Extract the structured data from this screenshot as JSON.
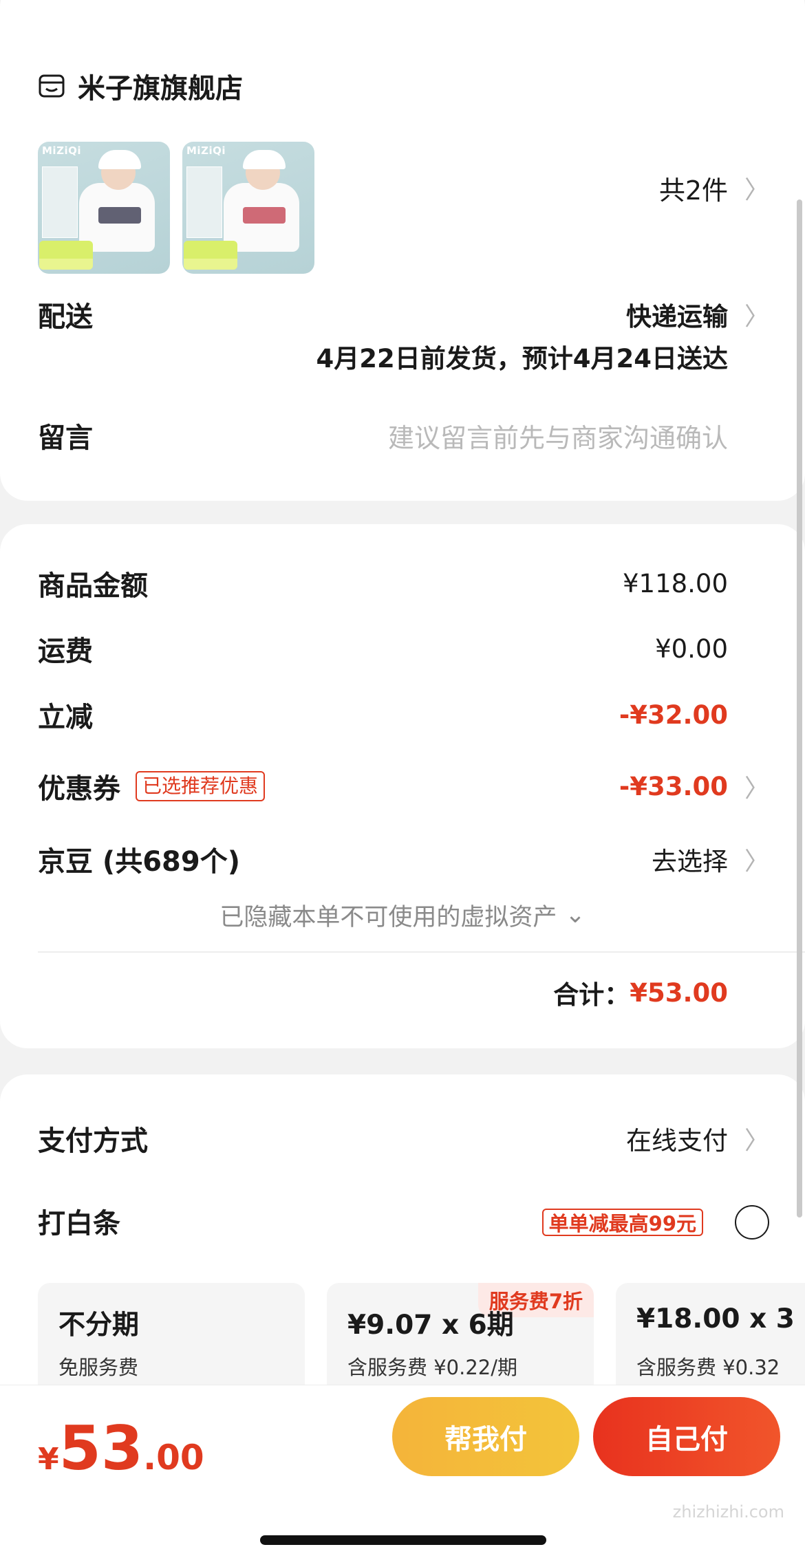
{
  "shop": {
    "name": "米子旗旗舰店",
    "icon": "shop-icon",
    "item_count": "共2件",
    "thumb_brand": "MiZiQi"
  },
  "delivery": {
    "label": "配送",
    "method": "快递运输",
    "date_text": "4月22日前发货，预计4月24日送达"
  },
  "message": {
    "label": "留言",
    "placeholder": "建议留言前先与商家沟通确认"
  },
  "price_rows": {
    "goods": {
      "label": "商品金额",
      "value": "¥118.00"
    },
    "shipping": {
      "label": "运费",
      "value": "¥0.00"
    },
    "discount": {
      "label": "立减",
      "value": "-¥32.00"
    },
    "coupon": {
      "label": "优惠券",
      "badge": "已选推荐优惠",
      "value": "-¥33.00"
    },
    "jingdou": {
      "label": "京豆 (共689个)",
      "value": "去选择"
    },
    "hidden_assets": "已隐藏本单不可使用的虚拟资产",
    "total_label": "合计：",
    "total_value": "¥53.00"
  },
  "payment": {
    "method_label": "支付方式",
    "method_value": "在线支付",
    "baitiao_label": "打白条",
    "baitiao_badge": "单单减最高99元",
    "plans": [
      {
        "title": "不分期",
        "sub": "免服务费",
        "flag": ""
      },
      {
        "title": "¥9.07 x 6期",
        "sub": "含服务费 ¥0.22/期",
        "flag": "服务费7折"
      },
      {
        "title": "¥18.00 x 3",
        "sub": "含服务费 ¥0.32",
        "flag": ""
      }
    ]
  },
  "bottom": {
    "price_symbol": "¥",
    "price_int": "53",
    "price_dec": ".00",
    "help_pay": "帮我付",
    "self_pay": "自己付"
  },
  "watermark": "zhizhizhi.com",
  "colors": {
    "accent_red": "#e03a1f",
    "help_btn": "#f4b43a",
    "self_btn": "#e8321e"
  }
}
